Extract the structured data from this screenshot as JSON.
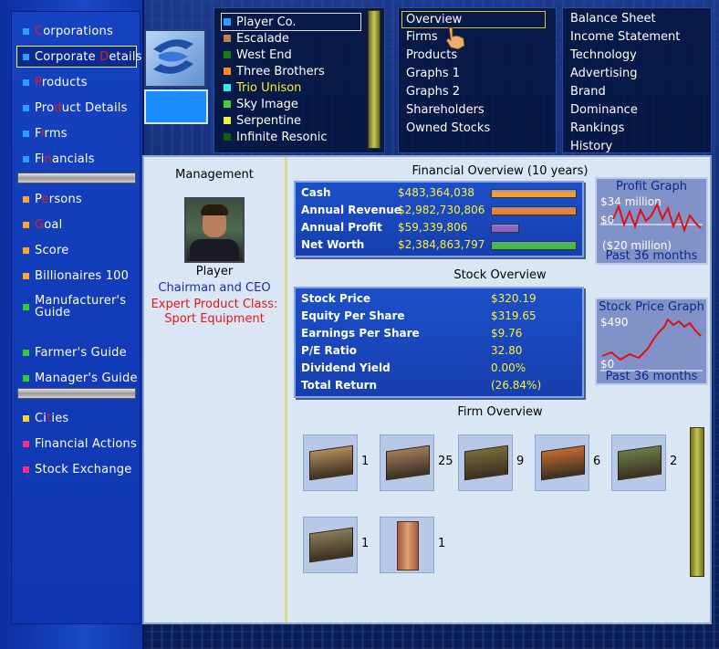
{
  "sidebar": {
    "items": [
      {
        "id": "corporations",
        "pre": "",
        "hl": "C",
        "post": "orporations",
        "color": "#2aa0ff"
      },
      {
        "id": "corporate-details",
        "pre": "Corporate ",
        "hl": "D",
        "post": "etails",
        "color": "#2aa0ff",
        "active": true
      },
      {
        "id": "products",
        "pre": "",
        "hl": "P",
        "post": "roducts",
        "color": "#2aa0ff"
      },
      {
        "id": "product-details",
        "pre": "Pro",
        "hl": "d",
        "post": "uct Details",
        "color": "#2aa0ff"
      },
      {
        "id": "firms",
        "pre": "F",
        "hl": "i",
        "post": "rms",
        "color": "#2aa0ff"
      },
      {
        "id": "financials",
        "pre": "Fi",
        "hl": "n",
        "post": "ancials",
        "color": "#2aa0ff"
      },
      {
        "id": "persons",
        "pre": "P",
        "hl": "e",
        "post": "rsons",
        "color": "#ffa52a"
      },
      {
        "id": "goal",
        "pre": "",
        "hl": "G",
        "post": "oal",
        "color": "#ffa52a"
      },
      {
        "id": "score",
        "pre": "Score",
        "hl": "",
        "post": "",
        "color": "#ffa52a"
      },
      {
        "id": "billionaires",
        "pre": "Billionaires 100",
        "hl": "",
        "post": "",
        "color": "#ffa52a"
      },
      {
        "id": "manufacturers-guide",
        "pre": "Manufacturer's Guide",
        "hl": "",
        "post": "",
        "color": "#2fd02f"
      },
      {
        "id": "farmers-guide",
        "pre": "Farmer's Guide",
        "hl": "",
        "post": "",
        "color": "#2fd02f"
      },
      {
        "id": "managers-guide",
        "pre": "Manager's Guide",
        "hl": "",
        "post": "",
        "color": "#2fd02f"
      },
      {
        "id": "cities",
        "pre": "Ci",
        "hl": "t",
        "post": "ies",
        "color": "#ffd02a"
      },
      {
        "id": "financial-actions",
        "pre": "Financial Actions",
        "hl": "",
        "post": "",
        "color": "#ff2a8a"
      },
      {
        "id": "stock-exchange",
        "pre": "Stock Exchange",
        "hl": "",
        "post": "",
        "color": "#ff2a8a"
      }
    ]
  },
  "companies": [
    {
      "label": "Player Co.",
      "color": "#2aa0ff",
      "text_color": "#ffffff",
      "selected": true
    },
    {
      "label": "Escalade",
      "color": "#c08050",
      "text_color": "#ffffff"
    },
    {
      "label": "West End",
      "color": "#1a7a1a",
      "text_color": "#ffffff"
    },
    {
      "label": "Three Brothers",
      "color": "#ff8a1a",
      "text_color": "#ffffff"
    },
    {
      "label": "Trio Unison",
      "color": "#2af0f0",
      "text_color": "#ffef3a"
    },
    {
      "label": "Sky Image",
      "color": "#40d040",
      "text_color": "#ffffff"
    },
    {
      "label": "Serpentine",
      "color": "#f0f040",
      "text_color": "#ffffff"
    },
    {
      "label": "Infinite Resonic",
      "color": "#106010",
      "text_color": "#ffffff"
    }
  ],
  "menu_a": [
    "Overview",
    "Firms",
    "Products",
    "Graphs 1",
    "Graphs 2",
    "Shareholders",
    "Owned Stocks"
  ],
  "menu_b": [
    "Balance Sheet",
    "Income Statement",
    "Technology",
    "Advertising",
    "Brand",
    "Dominance",
    "Rankings",
    "History"
  ],
  "management": {
    "title": "Management",
    "name": "Player",
    "role": "Chairman and CEO",
    "expert_line1": "Expert Product Class:",
    "expert_line2": "Sport Equipment"
  },
  "financial": {
    "title": "Financial Overview (10 years)",
    "rows": [
      {
        "label": "Cash",
        "value": "$483,364,038",
        "bar_color": "#f0a030",
        "bar_fill": 1.0
      },
      {
        "label": "Annual Revenue",
        "value": "$2,982,730,806",
        "bar_color": "#f08030",
        "bar_fill": 1.0
      },
      {
        "label": "Annual Profit",
        "value": "$59,339,806",
        "bar_color": "#9060c0",
        "bar_fill": 0.32
      },
      {
        "label": "Net Worth",
        "value": "$2,384,863,797",
        "bar_color": "#40c040",
        "bar_fill": 1.0
      }
    ],
    "graph": {
      "title": "Profit Graph",
      "top": "$34 million",
      "zero": "$0",
      "bottom": "($20 million)",
      "period": "Past 36 months"
    }
  },
  "stock": {
    "title": "Stock Overview",
    "rows": [
      {
        "label": "Stock Price",
        "value": "$320.19"
      },
      {
        "label": "Equity Per Share",
        "value": "$319.65"
      },
      {
        "label": "Earnings Per Share",
        "value": "$9.76"
      },
      {
        "label": "P/E Ratio",
        "value": "32.80"
      },
      {
        "label": "Dividend Yield",
        "value": "0.00%"
      },
      {
        "label": "Total Return",
        "value": "(26.84%)"
      }
    ],
    "graph": {
      "title": "Stock Price Graph",
      "top": "$490",
      "zero": "$0",
      "period": "Past 36 months"
    }
  },
  "firms": {
    "title": "Firm Overview",
    "items": [
      {
        "icon": "warehouse-building-icon",
        "count": "1"
      },
      {
        "icon": "department-store-building-icon",
        "count": "25"
      },
      {
        "icon": "factory-building-icon",
        "count": "9"
      },
      {
        "icon": "farm-building-icon",
        "count": "6"
      },
      {
        "icon": "residential-building-icon",
        "count": "2"
      },
      {
        "icon": "mine-building-icon",
        "count": "1"
      },
      {
        "icon": "office-tower-building-icon",
        "count": "1"
      }
    ]
  }
}
